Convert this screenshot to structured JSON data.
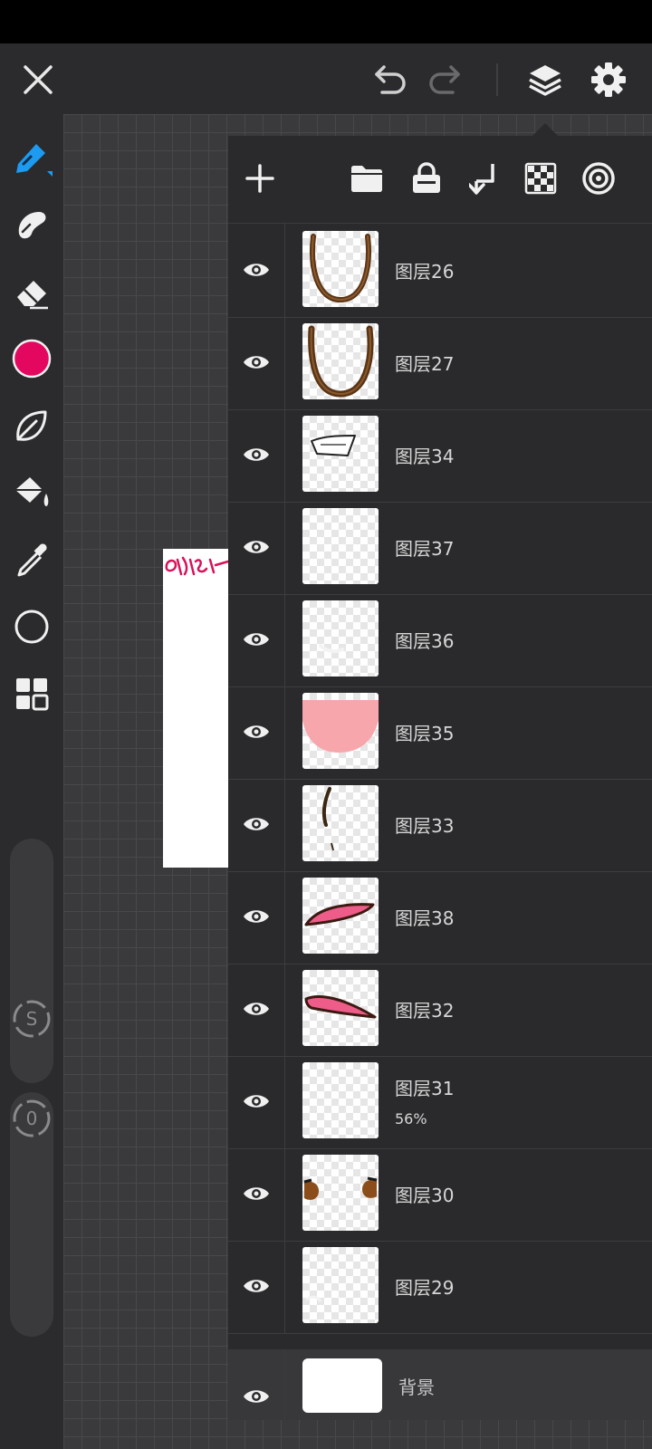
{
  "app": {
    "accent_color": "#1d9bf0",
    "current_brush_color": "#e3075f"
  },
  "topbar": {
    "close_icon": "close-icon",
    "undo_icon": "undo-icon",
    "redo_icon": "redo-icon",
    "layers_icon": "layers-icon",
    "settings_icon": "gear-icon"
  },
  "toolbar": {
    "tools": [
      "pen-icon",
      "smudge-icon",
      "eraser-icon",
      "color-swatch",
      "leaf-brush-icon",
      "bucket-fill-icon",
      "eyedropper-icon",
      "shape-circle-icon",
      "grid-menu-icon"
    ],
    "size_slider_label": "S",
    "opacity_slider_label": "0"
  },
  "layer_panel": {
    "header_icons": [
      "add-layer-icon",
      "folder-icon",
      "lock-icon",
      "merge-down-icon",
      "transparency-icon",
      "blend-mode-icon"
    ],
    "layers": [
      {
        "name": "图层26",
        "opacity": ""
      },
      {
        "name": "图层27",
        "opacity": ""
      },
      {
        "name": "图层34",
        "opacity": ""
      },
      {
        "name": "图层37",
        "opacity": ""
      },
      {
        "name": "图层36",
        "opacity": ""
      },
      {
        "name": "图层35",
        "opacity": ""
      },
      {
        "name": "图层33",
        "opacity": ""
      },
      {
        "name": "图层38",
        "opacity": ""
      },
      {
        "name": "图层32",
        "opacity": ""
      },
      {
        "name": "图层31",
        "opacity": "56%"
      },
      {
        "name": "图层30",
        "opacity": ""
      },
      {
        "name": "图层29",
        "opacity": ""
      }
    ],
    "background_layer": {
      "name": "背景"
    }
  }
}
